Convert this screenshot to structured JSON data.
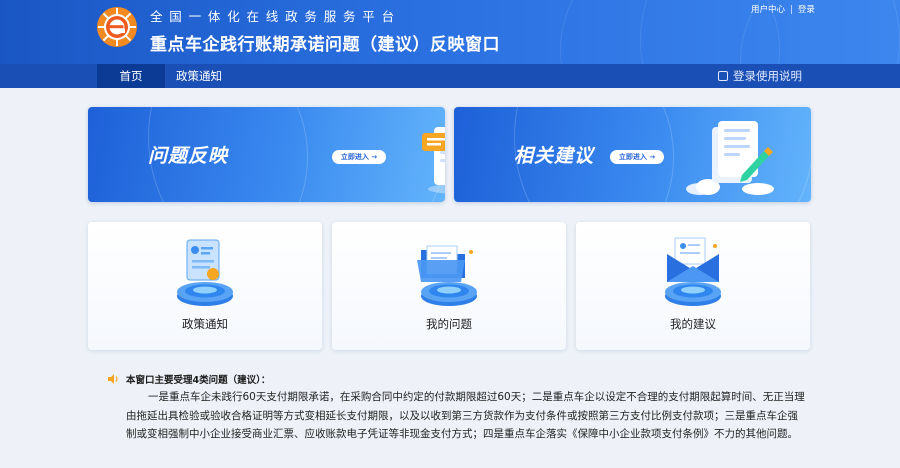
{
  "header": {
    "sup_title": "全国一体化在线政务服务平台",
    "main_title": "重点车企践行账期承诺问题（建议）反映窗口",
    "user_center": "用户中心",
    "separator": "|",
    "login": "登录",
    "logo_icon": "gov-platform-logo",
    "logo_letter": "e"
  },
  "nav": {
    "items": [
      {
        "label": "首页",
        "active": true
      },
      {
        "label": "政策通知",
        "active": false
      }
    ],
    "help": "登录使用说明",
    "help_icon": "book-icon"
  },
  "banners": [
    {
      "title": "问题反映",
      "button": "立即进入 →"
    },
    {
      "title": "相关建议",
      "button": "立即进入 →"
    }
  ],
  "cards": [
    {
      "label": "政策通知",
      "icon": "policy-document-icon"
    },
    {
      "label": "我的问题",
      "icon": "folder-icon"
    },
    {
      "label": "我的建议",
      "icon": "envelope-icon"
    }
  ],
  "notice": {
    "icon": "speaker-icon",
    "title": "本窗口主要受理4类问题（建议）：",
    "body": "一是重点车企未践行60天支付期限承诺，在采购合同中约定的付款期限超过60天；二是重点车企以设定不合理的支付期限起算时间、无正当理由拖延出具检验或验收合格证明等方式变相延长支付期限，以及以收到第三方货款作为支付条件或按照第三方支付比例支付款项；三是重点车企强制或变相强制中小企业接受商业汇票、应收账款电子凭证等非现金支付方式；四是重点车企落实《保障中小企业款项支付条例》不力的其他问题。"
  },
  "colors": {
    "header_blue": "#2a6fe0",
    "nav_blue": "#1a4fb6",
    "nav_active": "#0b3b95",
    "logo_orange": "#ef5a1f",
    "page_bg": "#eef2f8"
  }
}
